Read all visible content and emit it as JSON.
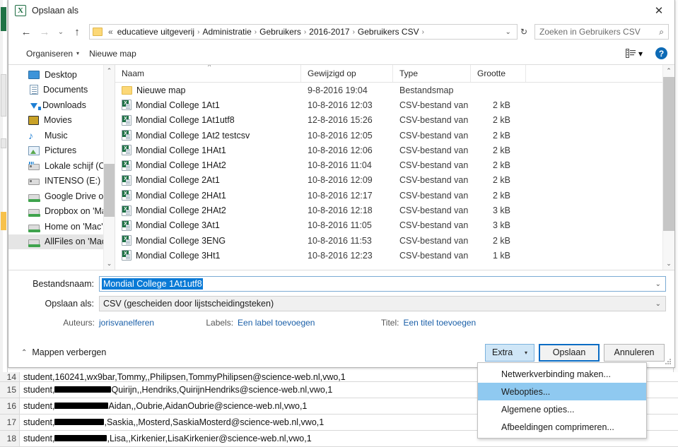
{
  "dialog": {
    "title": "Opslaan als",
    "app_icon": "excel-icon",
    "close_label": "✕"
  },
  "nav": {
    "back_icon": "back-arrow-icon",
    "forward_icon": "forward-arrow-icon",
    "recent_icon": "recent-locations-icon",
    "up_icon": "up-arrow-icon",
    "overflow": "«",
    "breadcrumbs": [
      "educatieve uitgeverij",
      "Administratie",
      "Gebruikers",
      "2016-2017",
      "Gebruikers CSV"
    ],
    "separator": "›",
    "dropdown_icon": "chevron-down-icon",
    "refresh_icon": "↻"
  },
  "search": {
    "placeholder": "Zoeken in Gebruikers CSV",
    "value": "",
    "icon": "search-icon"
  },
  "commandbar": {
    "organize_label": "Organiseren",
    "organize_caret": "▾",
    "newfolder_label": "Nieuwe map",
    "view_icon": "view-options-icon",
    "view_caret": "▾",
    "help_label": "?"
  },
  "sidebar": {
    "items": [
      {
        "label": "Desktop",
        "icon": "desktop-icon",
        "type": "desktop"
      },
      {
        "label": "Documents",
        "icon": "documents-icon",
        "type": "docs"
      },
      {
        "label": "Downloads",
        "icon": "downloads-icon",
        "type": "dl"
      },
      {
        "label": "Movies",
        "icon": "movies-icon",
        "type": "mov"
      },
      {
        "label": "Music",
        "icon": "music-icon",
        "type": "music"
      },
      {
        "label": "Pictures",
        "icon": "pictures-icon",
        "type": "pic"
      },
      {
        "label": "Lokale schijf (C:)",
        "icon": "local-disk-icon",
        "type": "drivewin"
      },
      {
        "label": "INTENSO (E:)",
        "icon": "usb-drive-icon",
        "type": "drive"
      },
      {
        "label": "Google Drive on",
        "icon": "network-drive-icon",
        "type": "net"
      },
      {
        "label": "Dropbox on 'Ma",
        "icon": "network-drive-icon",
        "type": "net"
      },
      {
        "label": "Home on 'Mac'",
        "icon": "network-drive-icon",
        "type": "net"
      },
      {
        "label": "AllFiles on 'Mac'",
        "icon": "network-drive-icon",
        "type": "net",
        "selected": true
      }
    ]
  },
  "filelist": {
    "columns": [
      "Naam",
      "Gewijzigd op",
      "Type",
      "Grootte"
    ],
    "sorted_column": "Naam",
    "sort_indicator": "^",
    "rows": [
      {
        "name": "Nieuwe map",
        "modified": "9-8-2016 19:04",
        "type": "Bestandsmap",
        "size": "",
        "icon": "folder-icon"
      },
      {
        "name": "Mondial College  1At1",
        "modified": "10-8-2016 12:03",
        "type": "CSV-bestand van ...",
        "size": "2 kB",
        "icon": "csv-file-icon"
      },
      {
        "name": "Mondial College  1At1utf8",
        "modified": "12-8-2016 15:26",
        "type": "CSV-bestand van ...",
        "size": "2 kB",
        "icon": "csv-file-icon"
      },
      {
        "name": "Mondial College  1At2 testcsv",
        "modified": "10-8-2016 12:05",
        "type": "CSV-bestand van ...",
        "size": "2 kB",
        "icon": "csv-file-icon"
      },
      {
        "name": "Mondial College  1HAt1",
        "modified": "10-8-2016 12:06",
        "type": "CSV-bestand van ...",
        "size": "2 kB",
        "icon": "csv-file-icon"
      },
      {
        "name": "Mondial College  1HAt2",
        "modified": "10-8-2016 11:04",
        "type": "CSV-bestand van ...",
        "size": "2 kB",
        "icon": "csv-file-icon"
      },
      {
        "name": "Mondial College  2At1",
        "modified": "10-8-2016 12:09",
        "type": "CSV-bestand van ...",
        "size": "2 kB",
        "icon": "csv-file-icon"
      },
      {
        "name": "Mondial College  2HAt1",
        "modified": "10-8-2016 12:17",
        "type": "CSV-bestand van ...",
        "size": "2 kB",
        "icon": "csv-file-icon"
      },
      {
        "name": "Mondial College  2HAt2",
        "modified": "10-8-2016 12:18",
        "type": "CSV-bestand van ...",
        "size": "3 kB",
        "icon": "csv-file-icon"
      },
      {
        "name": "Mondial College  3At1",
        "modified": "10-8-2016 11:05",
        "type": "CSV-bestand van ...",
        "size": "3 kB",
        "icon": "csv-file-icon"
      },
      {
        "name": "Mondial College  3ENG",
        "modified": "10-8-2016 11:53",
        "type": "CSV-bestand van ...",
        "size": "2 kB",
        "icon": "csv-file-icon"
      },
      {
        "name": "Mondial College  3Ht1",
        "modified": "10-8-2016 12:23",
        "type": "CSV-bestand van ...",
        "size": "1 kB",
        "icon": "csv-file-icon"
      }
    ]
  },
  "form": {
    "filename_label": "Bestandsnaam:",
    "filename_value": "Mondial College  1At1utf8",
    "savetype_label": "Opslaan als:",
    "savetype_value": "CSV (gescheiden door lijstscheidingsteken)",
    "authors_label": "Auteurs:",
    "authors_value": "jorisvanelferen",
    "labels_label": "Labels:",
    "labels_value": "Een label toevoegen",
    "title_label": "Titel:",
    "title_value": "Een titel toevoegen"
  },
  "footer": {
    "hide_folders_label": "Mappen verbergen",
    "hide_folders_caret": "⌃",
    "extra_label": "Extra",
    "extra_caret": "▾",
    "save_label": "Opslaan",
    "cancel_label": "Annuleren"
  },
  "extra_menu": {
    "items": [
      {
        "label": "Netwerkverbinding maken...",
        "highlighted": false
      },
      {
        "label": "Webopties...",
        "highlighted": true
      },
      {
        "label": "Algemene opties...",
        "highlighted": false
      },
      {
        "label": "Afbeeldingen comprimeren...",
        "highlighted": false
      }
    ]
  },
  "excel_background": {
    "rows": [
      {
        "num": "14",
        "prefix": "student,160241,wx9bar,Tommy,,Philipsen,TommyPhilipsen@science-web.nl,vwo,1",
        "redacted": false,
        "suffix": ""
      },
      {
        "num": "15",
        "prefix": "student,",
        "redacted": true,
        "redact_width": 80,
        "suffix": "Quirijn,,Hendriks,QuirijnHendriks@science-web.nl,vwo,1"
      },
      {
        "num": "16",
        "prefix": "student,",
        "redacted": true,
        "redact_width": 76,
        "suffix": "Aidan,,Oubrie,AidanOubrie@science-web.nl,vwo,1"
      },
      {
        "num": "17",
        "prefix": "student,",
        "redacted": true,
        "redact_width": 70,
        "suffix": ",Saskia,,Mosterd,SaskiaMosterd@science-web.nl,vwo,1"
      },
      {
        "num": "18",
        "prefix": "student,",
        "redacted": true,
        "redact_width": 74,
        "suffix": ",Lisa,,Kirkenier,LisaKirkenier@science-web.nl,vwo,1"
      }
    ]
  },
  "colors": {
    "accent_blue": "#0a7ad6",
    "menu_highlight": "#8fc9f0",
    "excel_green": "#217346",
    "link_blue": "#1a5fa8",
    "folder_yellow": "#fcd877"
  }
}
